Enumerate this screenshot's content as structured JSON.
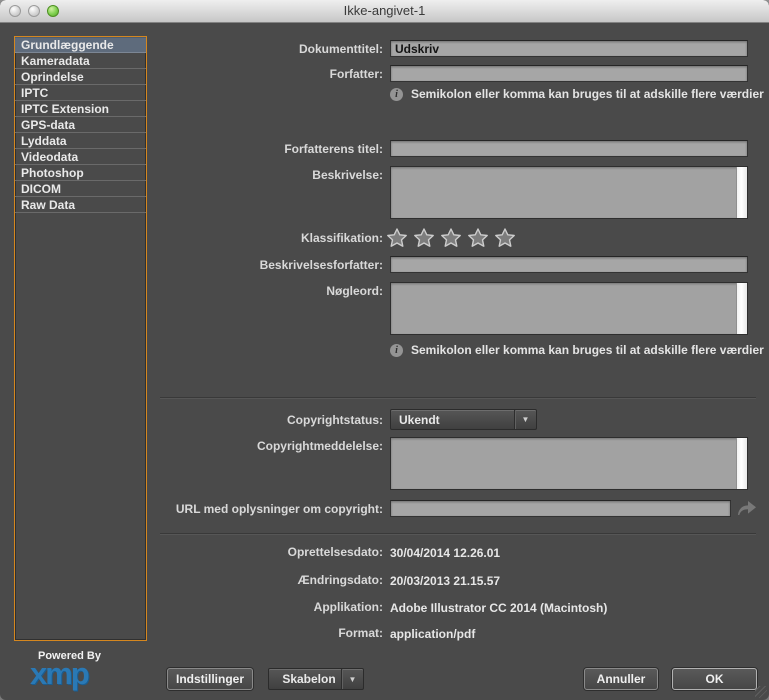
{
  "window": {
    "title": "Ikke-angivet-1"
  },
  "sidebar": {
    "items": [
      "Grundlæggende",
      "Kameradata",
      "Oprindelse",
      "IPTC",
      "IPTC Extension",
      "GPS-data",
      "Lyddata",
      "Videodata",
      "Photoshop",
      "DICOM",
      "Raw Data"
    ],
    "selected": "Grundlæggende"
  },
  "form": {
    "hint": "Semikolon eller komma kan bruges til at adskille flere værdier",
    "document_title": {
      "label": "Dokumenttitel:",
      "value": "Udskriv"
    },
    "author": {
      "label": "Forfatter:",
      "value": ""
    },
    "author_title": {
      "label": "Forfatterens titel:",
      "value": ""
    },
    "description": {
      "label": "Beskrivelse:",
      "value": ""
    },
    "rating": {
      "label": "Klassifikation:",
      "stars_total": 5,
      "stars_filled": 0
    },
    "description_writer": {
      "label": "Beskrivelsesforfatter:",
      "value": ""
    },
    "keywords": {
      "label": "Nøgleord:",
      "value": ""
    },
    "copyright_status": {
      "label": "Copyrightstatus:",
      "value": "Ukendt"
    },
    "copyright_notice": {
      "label": "Copyrightmeddelelse:",
      "value": ""
    },
    "copyright_url": {
      "label": "URL med oplysninger om copyright:",
      "value": ""
    },
    "created_date": {
      "label": "Oprettelsesdato:",
      "value": "30/04/2014 12.26.01"
    },
    "modified_date": {
      "label": "Ændringsdato:",
      "value": "20/03/2013 21.15.57"
    },
    "application": {
      "label": "Applikation:",
      "value": "Adobe Illustrator CC 2014 (Macintosh)"
    },
    "format": {
      "label": "Format:",
      "value": "application/pdf"
    }
  },
  "footer": {
    "powered_by": "Powered By",
    "logo": "xmp",
    "settings_button": "Indstillinger",
    "template_button": "Skabelon",
    "cancel_button": "Annuller",
    "ok_button": "OK"
  },
  "colors": {
    "window_bg": "#4a4a4a",
    "field_bg": "#a6a6a6",
    "focus_ring_orange": "#d5871f",
    "selection_blue_gray": "#5e6b7c",
    "logo_blue": "#2a79b5",
    "traffic_green": "#6cc644"
  }
}
